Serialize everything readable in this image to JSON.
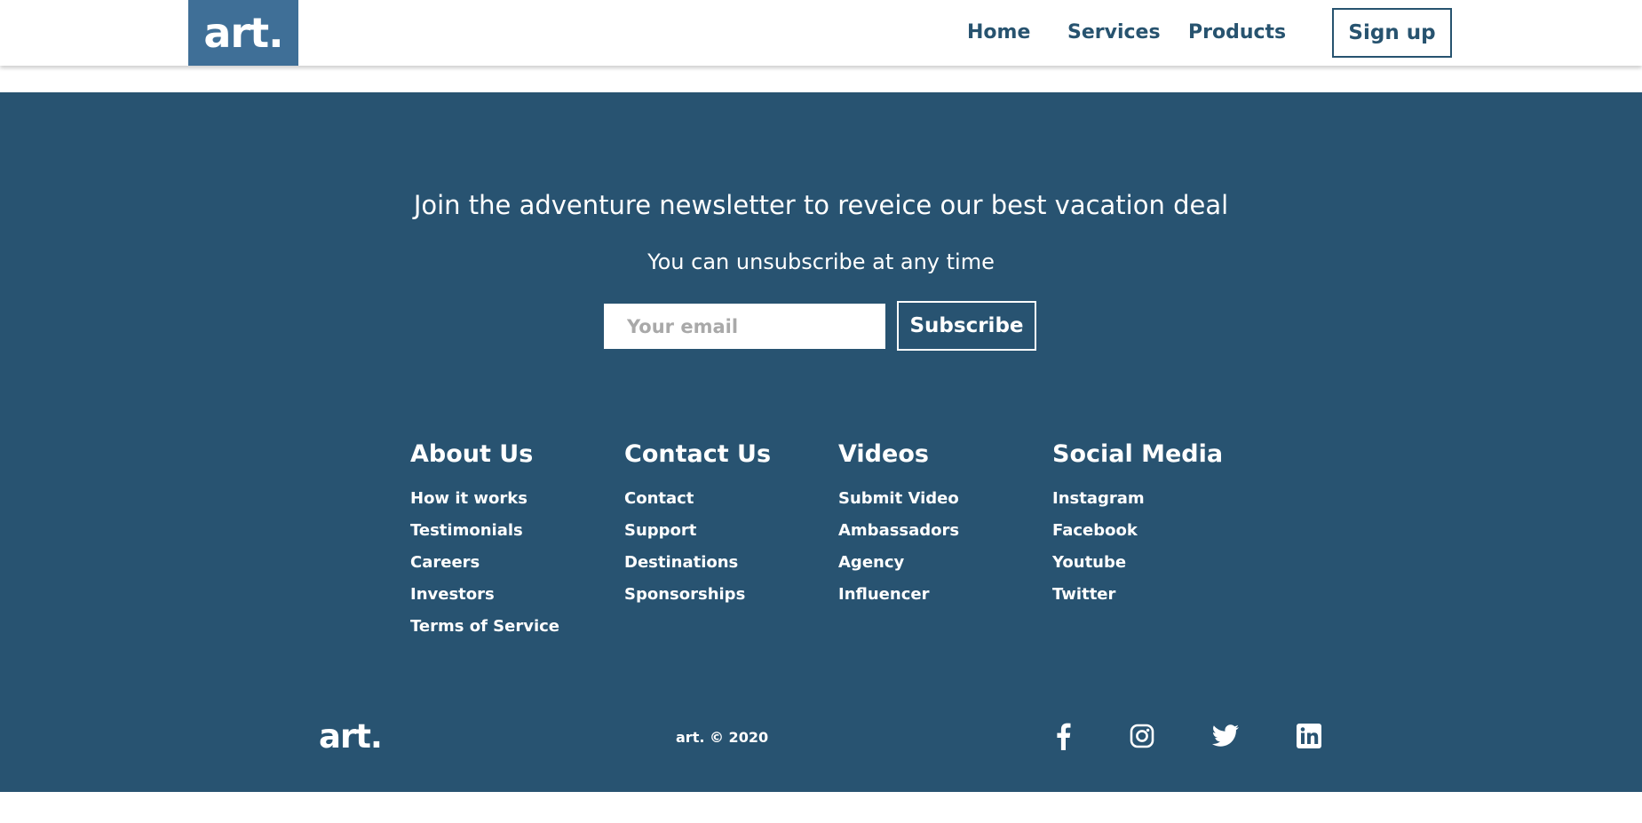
{
  "navbar": {
    "brand": "art.",
    "links": [
      "Home",
      "Services",
      "Products"
    ],
    "signup_label": "Sign up"
  },
  "newsletter": {
    "headline": "Join the adventure newsletter to reveice our best vacation deal",
    "subheadline": "You can unsubscribe at any time",
    "email_placeholder": "Your email",
    "subscribe_label": "Subscribe"
  },
  "columns": [
    {
      "title": "About Us",
      "links": [
        "How it works",
        "Testimonials",
        "Careers",
        "Investors",
        "Terms of Service"
      ]
    },
    {
      "title": "Contact Us",
      "links": [
        "Contact",
        "Support",
        "Destinations",
        "Sponsorships"
      ]
    },
    {
      "title": "Videos",
      "links": [
        "Submit Video",
        "Ambassadors",
        "Agency",
        "Influencer"
      ]
    },
    {
      "title": "Social Media",
      "links": [
        "Instagram",
        "Facebook",
        "Youtube",
        "Twitter"
      ]
    }
  ],
  "bottom": {
    "brand": "art.",
    "copyright": "art. © 2020",
    "social_icons": [
      "facebook-icon",
      "instagram-icon",
      "twitter-icon",
      "linkedin-icon"
    ]
  },
  "colors": {
    "brand_block": "#3f6f97",
    "footer_bg": "#285371",
    "nav_text": "#27536f"
  }
}
